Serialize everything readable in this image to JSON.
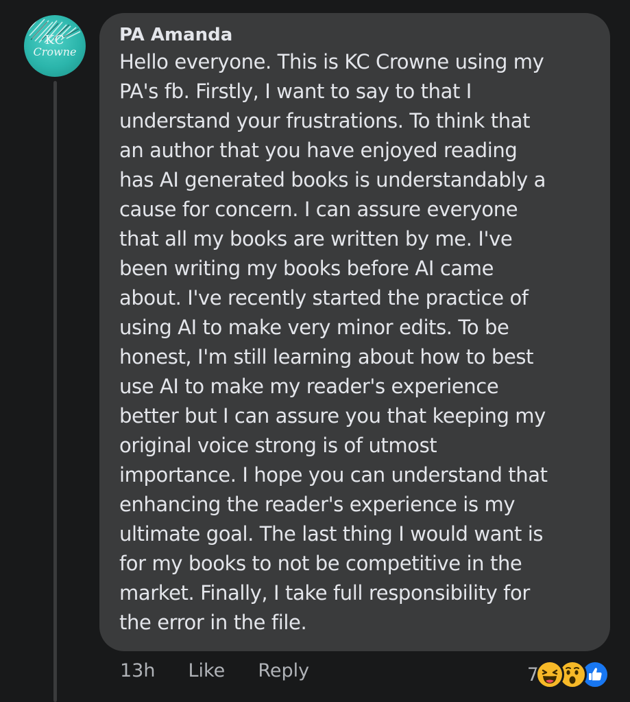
{
  "comment": {
    "author": "PA Amanda",
    "avatar": {
      "line1": "KC",
      "line2": "Crowne",
      "color": "#2bb5ab"
    },
    "text": "Hello everyone. This is KC Crowne using my\nPA's fb. Firstly, I want to say to that I\nunderstand your frustrations. To think that\nan author that you have enjoyed reading\nhas AI generated books is understandably a\ncause for concern. I can assure everyone\nthat all my books are written by me. I've\nbeen writing my books before AI came\nabout. I've recently started the practice of\nusing AI to make very minor edits. To be\nhonest, I'm still learning about how to best\nuse AI to make my reader's experience\nbetter but I can assure you that keeping my\noriginal voice strong is of utmost\nimportance. I hope you can understand that\nenhancing the reader's experience is my\nultimate goal. The last thing I would want is\nfor my books to not be competitive in the\nmarket. Finally, I take full responsibility for\nthe error in the file.",
    "time": "13h",
    "like_label": "Like",
    "reply_label": "Reply",
    "reactions": {
      "count": "7",
      "icons": [
        "haha-icon",
        "wow-icon",
        "like-icon"
      ]
    }
  },
  "colors": {
    "background": "#18191a",
    "bubble": "#3a3b3c",
    "text": "#e4e6eb",
    "meta": "#b0b3b8",
    "like_blue": "#1877f2",
    "emoji_yellow": "#f7b928"
  }
}
